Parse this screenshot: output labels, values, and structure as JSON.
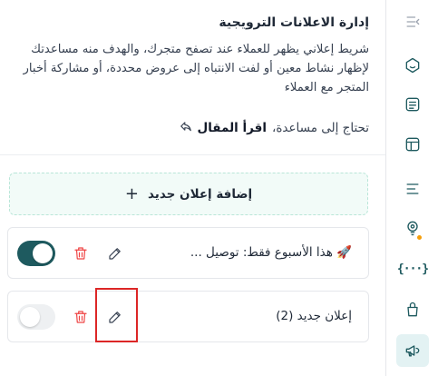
{
  "header": {
    "title": "إدارة الاعلانات الترويجية",
    "description": "شريط إعلاني يظهر للعملاء عند تصفح متجرك، والهدف منه مساعدتك لإظهار نشاط معين أو لفت الانتباه إلى عروض محددة، أو مشاركة أخبار المتجر مع العملاء",
    "help_text": "تحتاج إلى مساعدة،",
    "help_link": "اقرأ المقال"
  },
  "add_button": {
    "label": "إضافة إعلان جديد",
    "plus": "+"
  },
  "ads": [
    {
      "label": "🚀 هذا الأسبوع فقط: توصيل ...",
      "enabled": true
    },
    {
      "label": "إعلان جديد (2)",
      "enabled": false
    }
  ],
  "sidebar": {
    "items": [
      {
        "icon": "collapse-icon"
      },
      {
        "icon": "smile-icon"
      },
      {
        "icon": "id-card-icon"
      },
      {
        "icon": "layout-icon"
      },
      {
        "icon": "menu-lines-icon"
      },
      {
        "icon": "settings-bulb-icon"
      },
      {
        "icon": "braces-icon",
        "text": "{···}"
      },
      {
        "icon": "box-icon"
      },
      {
        "icon": "megaphone-icon",
        "active": true
      }
    ]
  },
  "colors": {
    "primary": "#1e5a5f",
    "danger": "#ef4444",
    "add_bg": "#f2fbf8",
    "add_border": "#b9e6d8",
    "highlight": "#dc2626"
  }
}
